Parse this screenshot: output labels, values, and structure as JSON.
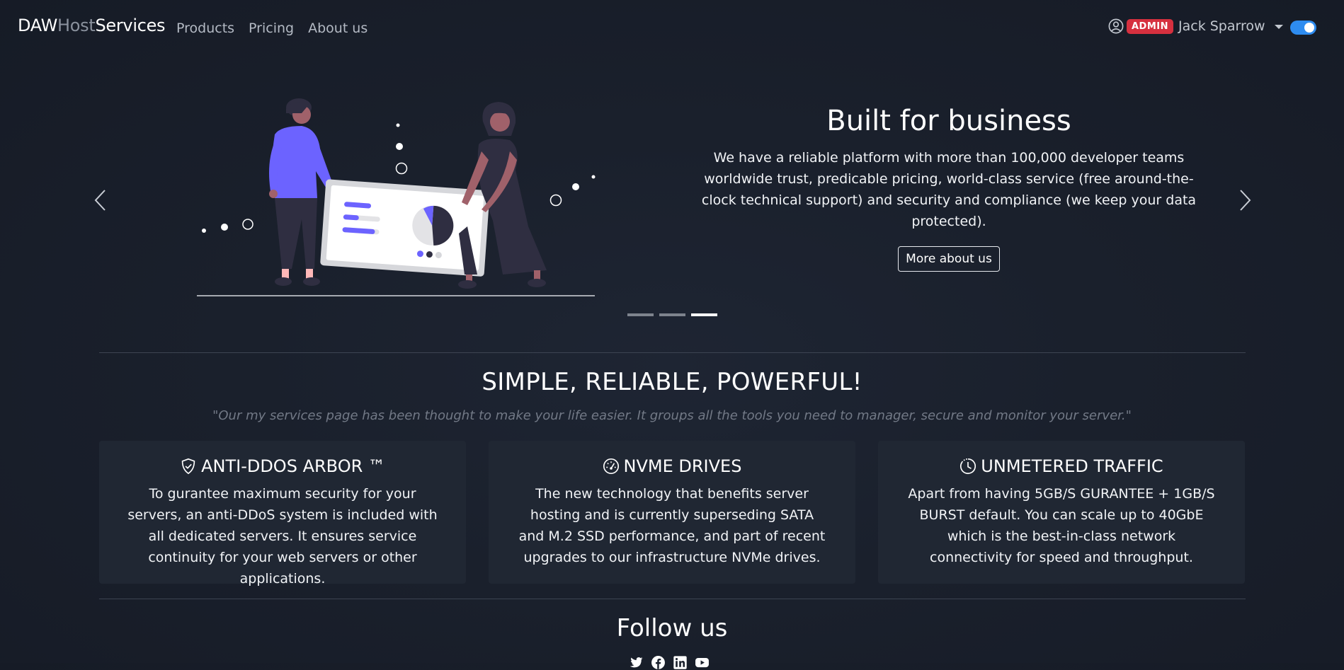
{
  "navbar": {
    "brand": {
      "part1": "DAW",
      "part2": "Host",
      "part3": "Services"
    },
    "links": [
      "Products",
      "Pricing",
      "About us"
    ],
    "user": {
      "badge": "ADMIN",
      "name": "Jack Sparrow"
    },
    "theme_toggle": {
      "on": true
    }
  },
  "hero": {
    "title": "Built for business",
    "description": "We have a reliable platform with more than 100,000 developer teams worldwide trust, predicable pricing, world-class service (free around-the-clock technical support) and security and compliance (we keep your data protected).",
    "button": "More about us",
    "indicators": {
      "count": 3,
      "active": 3
    }
  },
  "features": {
    "title": "SIMPLE, RELIABLE, POWERFUL!",
    "quote": "\"Our my services page has been thought to make your life easier. It groups all the tools you need to manager, secure and monitor your server.\"",
    "cards": [
      {
        "icon": "shield-check-icon",
        "title": "ANTI-DDOS ARBOR ™",
        "body": "To gurantee maximum security for your servers, an anti-DDoS system is included with all dedicated servers. It ensures service continuity for your web servers or other applications."
      },
      {
        "icon": "speedometer-icon",
        "title": "NVME DRIVES",
        "body": "The new technology that benefits server hosting and is currently superseding SATA and M.2 SSD performance, and part of recent upgrades to our infrastructure NVMe drives."
      },
      {
        "icon": "clock-history-icon",
        "title": "UNMETERED TRAFFIC",
        "body": "Apart from having 5GB/S GURANTEE + 1GB/S BURST default. You can scale up to 40GbE which is the best-in-class network connectivity for speed and throughput."
      }
    ]
  },
  "follow": {
    "title": "Follow us",
    "socials": [
      "twitter-icon",
      "facebook-icon",
      "linkedin-icon",
      "youtube-icon"
    ]
  },
  "colors": {
    "background": "#1a202c",
    "card": "#202733",
    "admin_badge": "#d6303f",
    "toggle": "#2e8cf0",
    "illustration_accent": "#6c63ff"
  }
}
